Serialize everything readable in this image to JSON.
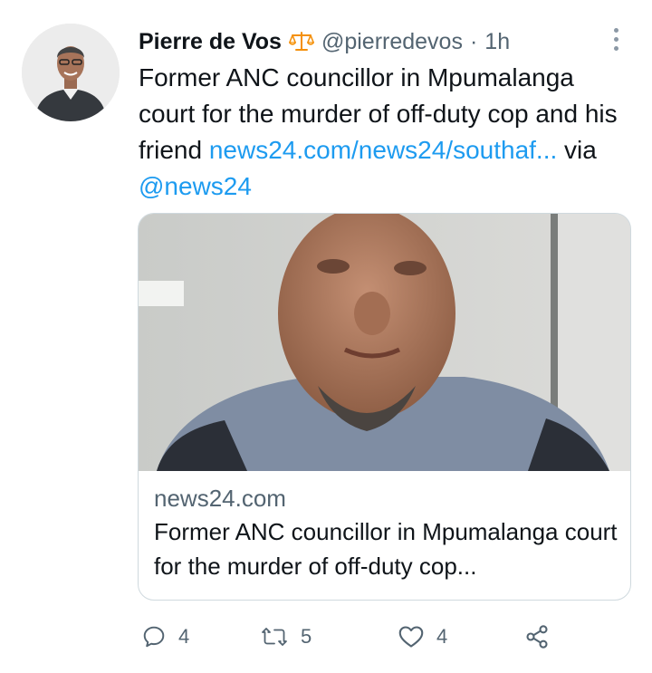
{
  "tweet": {
    "author_name": "Pierre de Vos",
    "author_handle": "@pierredevos",
    "separator": "·",
    "time": "1h",
    "text_before_link": "Former ANC councillor in Mpumalanga court for the murder of off-duty cop and his friend ",
    "link_text": "news24.com/news24/southaf...",
    "via_text": " via ",
    "mention": "@news24"
  },
  "card": {
    "domain": "news24.com",
    "title": "Former ANC councillor in Mpumalanga court for the murder of off-duty cop..."
  },
  "actions": {
    "reply_count": "4",
    "retweet_count": "5",
    "like_count": "4"
  },
  "icons": {
    "badge": "scales-icon",
    "more": "more-options-icon",
    "reply": "reply-icon",
    "retweet": "retweet-icon",
    "like": "heart-icon",
    "share": "share-icon"
  },
  "colors": {
    "link": "#1d9bf0",
    "secondary_text": "#536471",
    "badge_orange": "#f4900c"
  }
}
